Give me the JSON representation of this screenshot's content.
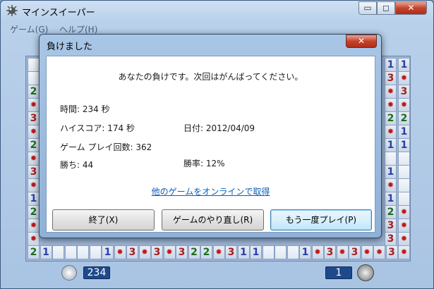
{
  "window": {
    "title": "マインスイーパー",
    "min_label": "▭",
    "max_label": "◻",
    "close_label": "✕"
  },
  "menu": {
    "game": "ゲーム(G)",
    "help": "ヘルプ(H)"
  },
  "board": {
    "left_cells": [
      "",
      "",
      "2",
      "m",
      "3",
      "m",
      "2",
      "m",
      "3",
      "m",
      "1",
      "2",
      "m",
      "m"
    ],
    "right_cells": [
      [
        "1",
        "1"
      ],
      [
        "3",
        "m"
      ],
      [
        "m",
        "3"
      ],
      [
        "m",
        "m"
      ],
      [
        "2",
        "2"
      ],
      [
        "m",
        "1"
      ],
      [
        "1",
        "1"
      ],
      [
        "",
        ""
      ],
      [
        "1",
        ""
      ],
      [
        "m",
        ""
      ],
      [
        "1",
        ""
      ],
      [
        "2",
        "m"
      ],
      [
        "3",
        "m"
      ],
      [
        "3",
        "m"
      ]
    ],
    "bottom_row": [
      "2",
      "1",
      "",
      "",
      "",
      "",
      "1",
      "m",
      "3",
      "m",
      "3",
      "m",
      "3",
      "2",
      "2",
      "m",
      "3",
      "1",
      "1",
      "",
      "",
      "",
      "1",
      "m",
      "3",
      "m",
      "3",
      "m",
      "m",
      "3",
      "m"
    ]
  },
  "status": {
    "time": "234",
    "mines": "1"
  },
  "dialog": {
    "title": "負けました",
    "close_label": "✕",
    "message": "あなたの負けです。次回はがんばってください。",
    "time": "時間: 234 秒",
    "high_score": "ハイスコア: 174 秒",
    "date": "日付: 2012/04/09",
    "games_played": "ゲーム プレイ回数: 362",
    "wins": "勝ち: 44",
    "win_rate": "勝率: 12%",
    "online_link": "他のゲームをオンラインで取得",
    "buttons": {
      "exit": "終了(X)",
      "restart": "ゲームのやり直し(R)",
      "play_again": "もう一度プレイ(P)"
    }
  },
  "colors": {
    "number_1": "#2a3fa8",
    "number_2": "#1e6b1e",
    "number_3": "#a52020",
    "mine": "#c01818",
    "link": "#0a5fb8"
  },
  "icons": {
    "title": "mine-icon",
    "clock": "clock-icon",
    "mine_counter": "mine-icon",
    "mine_cell": "mine-icon"
  }
}
